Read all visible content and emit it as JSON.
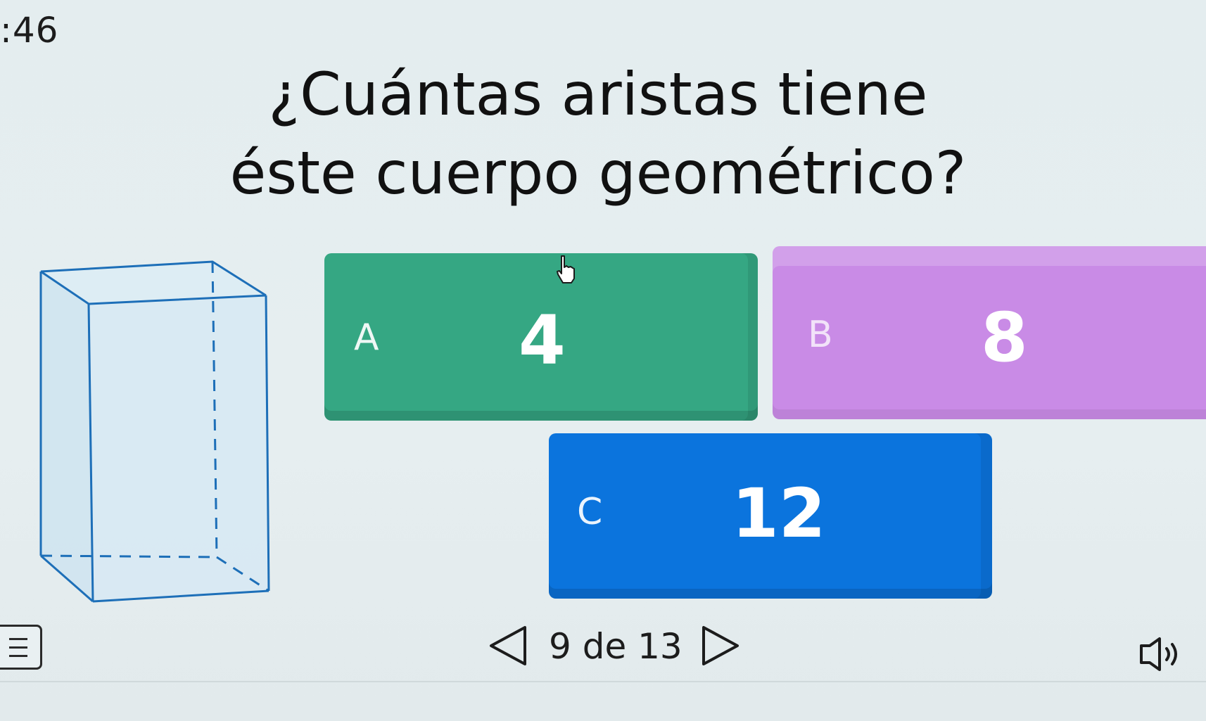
{
  "timer": ":46",
  "question": {
    "line1": "¿Cuántas aristas tiene",
    "line2": "éste cuerpo geométrico?"
  },
  "options": [
    {
      "letter": "A",
      "value": "4",
      "color": "#35a783"
    },
    {
      "letter": "B",
      "value": "8",
      "color": "#c98be6"
    },
    {
      "letter": "C",
      "value": "12",
      "color": "#0b74dd"
    }
  ],
  "figure": {
    "shape": "rectangular-prism",
    "edge_color": "#1d6fb8",
    "face_color": "#d6e8f2"
  },
  "pager": {
    "current": "9",
    "label": "9 de 13"
  },
  "icons": {
    "menu": "menu-icon",
    "prev": "triangle-left-icon",
    "next": "triangle-right-icon",
    "audio": "speaker-icon",
    "cursor": "hand-pointer-icon"
  }
}
